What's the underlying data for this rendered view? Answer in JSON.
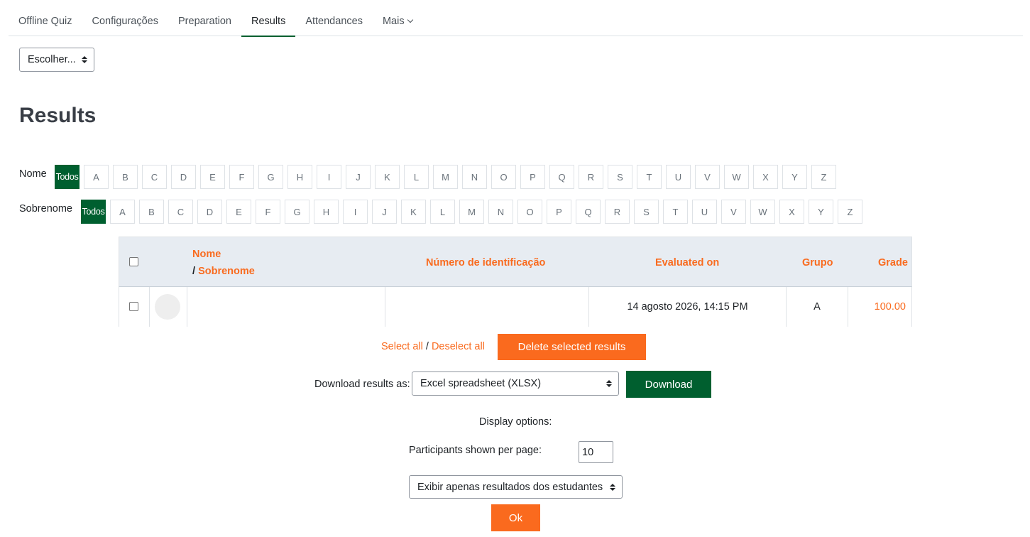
{
  "tabs": [
    {
      "label": "Offline Quiz",
      "active": false
    },
    {
      "label": "Configurações",
      "active": false
    },
    {
      "label": "Preparation",
      "active": false
    },
    {
      "label": "Results",
      "active": true
    },
    {
      "label": "Attendances",
      "active": false
    },
    {
      "label": "Mais",
      "active": false
    }
  ],
  "jump_select": {
    "value": "Escolher..."
  },
  "page_title": "Results",
  "initials": {
    "firstname_label": "Nome",
    "lastname_label": "Sobrenome",
    "all_label": "Todos",
    "letters": [
      "A",
      "B",
      "C",
      "D",
      "E",
      "F",
      "G",
      "H",
      "I",
      "J",
      "K",
      "L",
      "M",
      "N",
      "O",
      "P",
      "Q",
      "R",
      "S",
      "T",
      "U",
      "V",
      "W",
      "X",
      "Y",
      "Z"
    ]
  },
  "table": {
    "headers": {
      "firstname": "Nome",
      "separator": "/",
      "lastname": "Sobrenome",
      "idnumber": "Número de identificação",
      "evaluated_on": "Evaluated on",
      "group": "Grupo",
      "grade": "Grade"
    },
    "rows": [
      {
        "name": "",
        "idnumber": "",
        "evaluated_on": "14 agosto 2026, 14:15 PM",
        "group": "A",
        "grade": "100.00"
      }
    ]
  },
  "selection": {
    "select_all": "Select all",
    "separator": "/",
    "deselect_all": "Deselect all",
    "delete_button": "Delete selected results"
  },
  "download": {
    "label": "Download results as:",
    "format": "Excel spreadsheet (XLSX)",
    "button": "Download"
  },
  "display_options": {
    "heading": "Display options:",
    "per_page_label": "Participants shown per page:",
    "per_page_value": "10",
    "filter_value": "Exibir apenas resultados dos estudantes",
    "ok_button": "Ok"
  },
  "colors": {
    "brand_green": "#005f2f",
    "accent_orange": "#fa6a1e",
    "link_orange": "#f96b1f",
    "header_bg": "#e7ecf2"
  }
}
